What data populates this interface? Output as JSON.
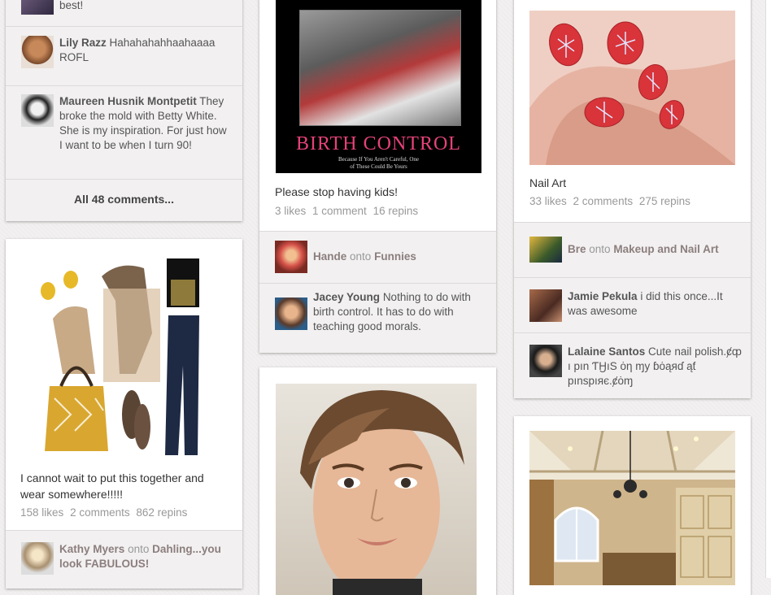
{
  "col1": {
    "top_comment_fragment": "best!",
    "comments": [
      {
        "user": "Lily Razz",
        "text": "Hahahahahhaahaaaa ROFL"
      },
      {
        "user": "Maureen Husnik Montpetit",
        "text": "They broke the mold with Betty White. She is my inspiration. For just how I want to be when I turn 90!"
      }
    ],
    "all_comments_label": "All 48 comments...",
    "pin2": {
      "description": "I cannot wait to put this together and wear somewhere!!!!!",
      "likes": "158 likes",
      "comments": "2 comments",
      "repins": "862 repins",
      "repin_user": "Kathy Myers",
      "onto": "onto",
      "board": "Dahling...you look FABULOUS!"
    }
  },
  "col2": {
    "pin1": {
      "poster_title": "BIRTH CONTROL",
      "poster_caption": "Because If You Aren't Careful, One of These Could Be Yours",
      "description": "Please stop having kids!",
      "likes": "3 likes",
      "comments": "1 comment",
      "repins": "16 repins",
      "repin_user": "Hande",
      "onto": "onto",
      "board": "Funnies",
      "comment_user": "Jacey Young",
      "comment_text": "Nothing to do with birth control. It has to do with teaching good morals."
    }
  },
  "col3": {
    "pin1": {
      "description": "Nail Art",
      "likes": "33 likes",
      "comments": "2 comments",
      "repins": "275 repins",
      "repin_user": "Bre",
      "onto": "onto",
      "board": "Makeup and Nail Art",
      "comments_list": [
        {
          "user": "Jamie Pekula",
          "text": "i did this once...It was awesome"
        },
        {
          "user": "Lalaine Santos",
          "text": "Cute nail polish.ȼȹ ı pın ƬӇıS ȯη ɱy ɓȯąяɗ ąƭ pınspıяє.ȼȯɱ"
        }
      ]
    }
  }
}
